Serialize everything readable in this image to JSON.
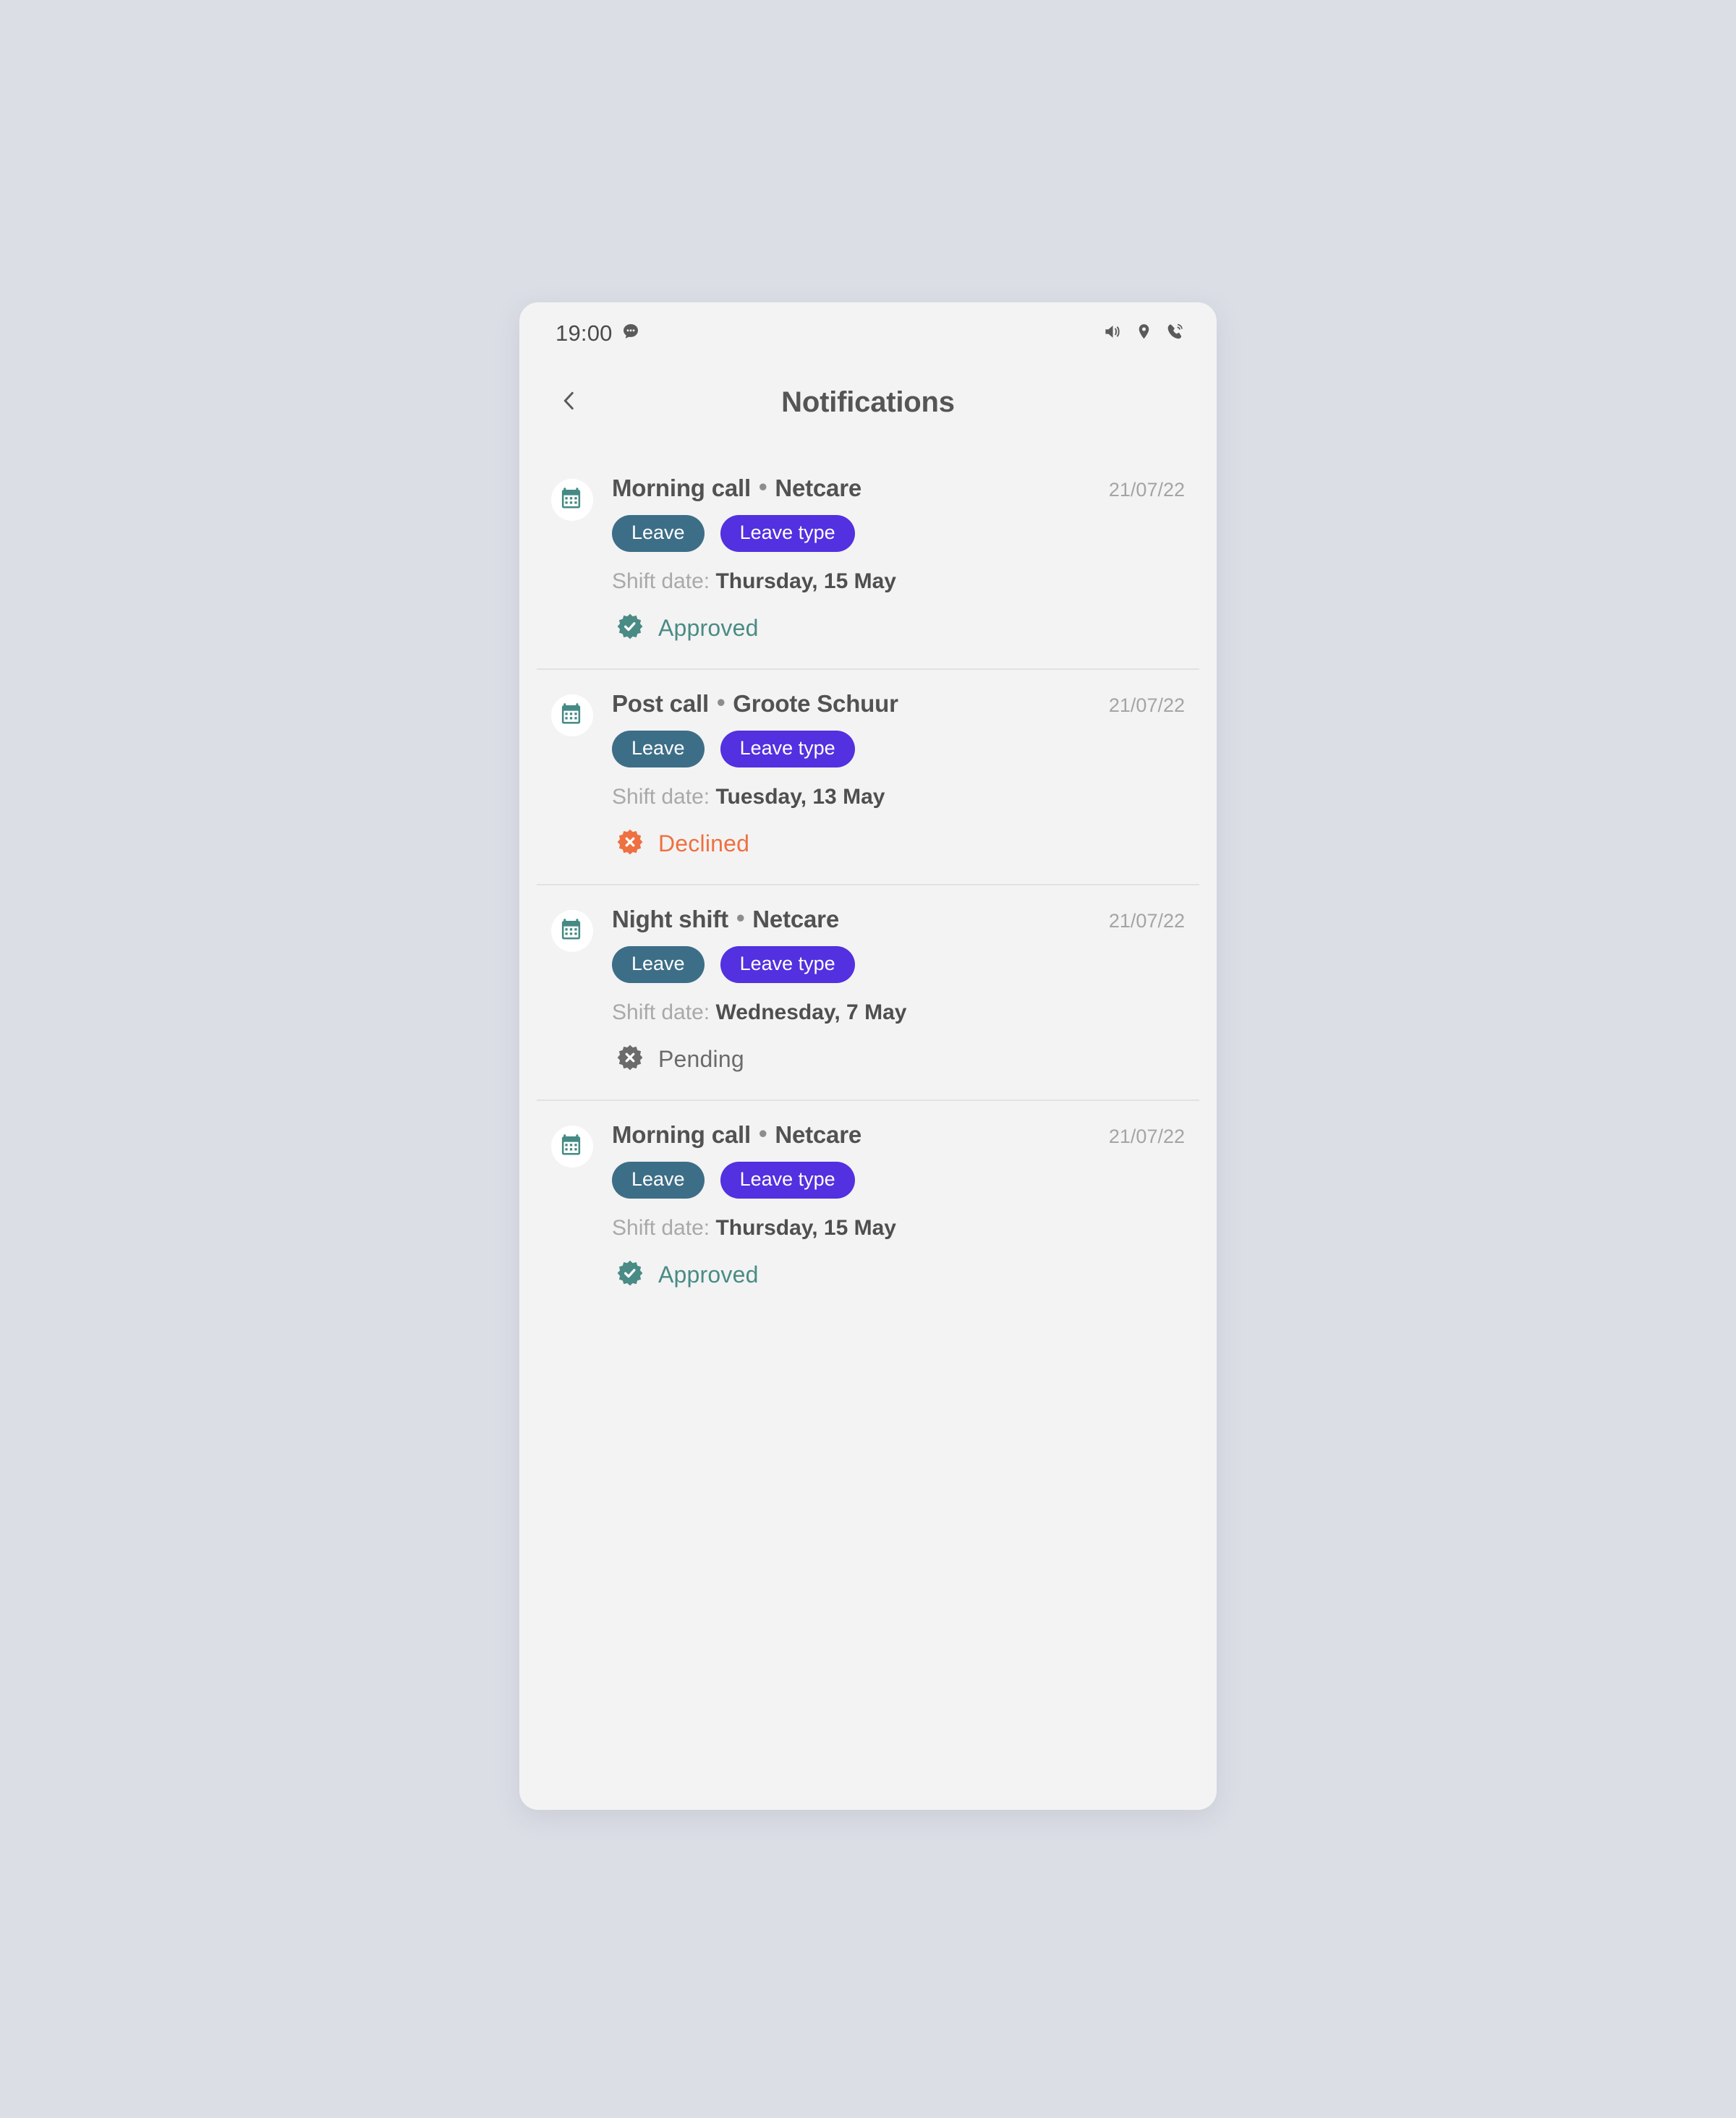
{
  "statusbar": {
    "time": "19:00",
    "message_icon": "chat-bubble-icon",
    "right_icons": [
      "volume-icon",
      "location-pin-icon",
      "phone-call-icon"
    ]
  },
  "header": {
    "back_icon": "chevron-left-icon",
    "title": "Notifications"
  },
  "colors": {
    "page_background": "#dcdee6",
    "screen_background": "#f3f3f3",
    "pill_leave": "#3d6e87",
    "pill_leave_type": "#5330e0",
    "approved": "#4a8b85",
    "declined": "#ef7040",
    "pending": "#6b6b6b",
    "calendar_icon": "#458a84"
  },
  "labels": {
    "shift_date_prefix": "Shift date:",
    "pill_leave": "Leave",
    "pill_leave_type": "Leave type"
  },
  "notifications": [
    {
      "icon": "calendar-icon",
      "shift_name": "Morning call",
      "organisation": "Netcare",
      "separator": "•",
      "stamp": "21/07/22",
      "pill_leave": "Leave",
      "pill_leave_type": "Leave type",
      "shift_date_prefix": "Shift date:",
      "shift_date": "Thursday, 15 May",
      "status": "Approved",
      "status_kind": "approved",
      "status_icon": "check-seal-icon"
    },
    {
      "icon": "calendar-icon",
      "shift_name": "Post call",
      "organisation": "Groote Schuur",
      "separator": "•",
      "stamp": "21/07/22",
      "pill_leave": "Leave",
      "pill_leave_type": "Leave type",
      "shift_date_prefix": "Shift date:",
      "shift_date": "Tuesday, 13 May",
      "status": "Declined",
      "status_kind": "declined",
      "status_icon": "cross-seal-icon"
    },
    {
      "icon": "calendar-icon",
      "shift_name": "Night shift",
      "organisation": "Netcare",
      "separator": "•",
      "stamp": "21/07/22",
      "pill_leave": "Leave",
      "pill_leave_type": "Leave type",
      "shift_date_prefix": "Shift date:",
      "shift_date": "Wednesday, 7 May",
      "status": "Pending",
      "status_kind": "pending",
      "status_icon": "cross-seal-icon"
    },
    {
      "icon": "calendar-icon",
      "shift_name": "Morning call",
      "organisation": "Netcare",
      "separator": "•",
      "stamp": "21/07/22",
      "pill_leave": "Leave",
      "pill_leave_type": "Leave type",
      "shift_date_prefix": "Shift date:",
      "shift_date": "Thursday, 15 May",
      "status": "Approved",
      "status_kind": "approved",
      "status_icon": "check-seal-icon"
    }
  ]
}
